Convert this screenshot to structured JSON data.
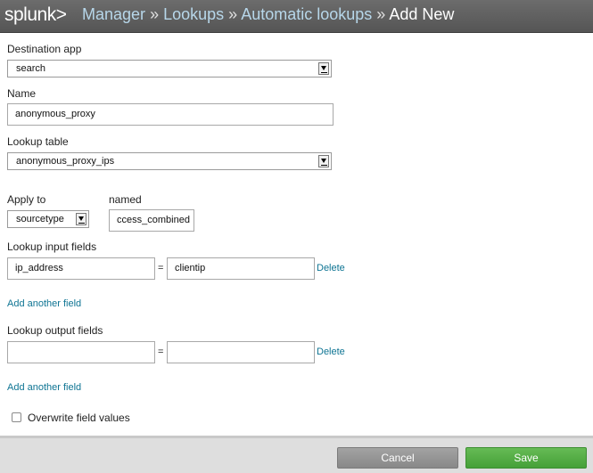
{
  "header": {
    "logo": "splunk>",
    "breadcrumb": {
      "manager": "Manager",
      "lookups": "Lookups",
      "automatic_lookups": "Automatic lookups",
      "current": "Add New",
      "separator": "»"
    }
  },
  "form": {
    "destination_app": {
      "label": "Destination app",
      "value": "search"
    },
    "name": {
      "label": "Name",
      "value": "anonymous_proxy"
    },
    "lookup_table": {
      "label": "Lookup table",
      "value": "anonymous_proxy_ips"
    },
    "apply_to": {
      "label": "Apply to",
      "value": "sourcetype"
    },
    "named": {
      "label": "named",
      "value": "ccess_combined"
    },
    "input_fields": {
      "label": "Lookup input fields",
      "rows": [
        {
          "left": "ip_address",
          "equals": "=",
          "right": "clientip",
          "delete": "Delete"
        }
      ],
      "add_link": "Add another field"
    },
    "output_fields": {
      "label": "Lookup output fields",
      "rows": [
        {
          "left": "",
          "equals": "=",
          "right": "",
          "delete": "Delete"
        }
      ],
      "add_link": "Add another field"
    },
    "overwrite": {
      "label": "Overwrite field values",
      "checked": false
    }
  },
  "footer": {
    "cancel_label": "Cancel",
    "save_label": "Save"
  }
}
